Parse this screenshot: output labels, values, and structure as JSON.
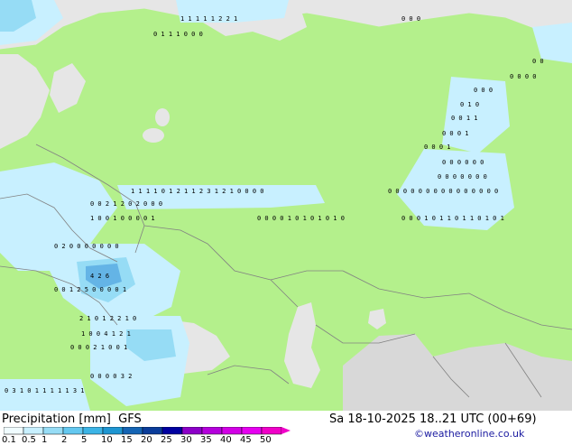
{
  "colors": {
    "land": "#b4f08c",
    "sea": "#e6e6e6",
    "precip_light": "#c8f0ff",
    "precip_mid": "#96dcf5",
    "precip_heavy": "#64b4e6",
    "precip_core": "#3c8cdc",
    "border": "#828282"
  },
  "footer": {
    "title": "Precipitation [mm]",
    "model": "GFS",
    "valid_time": "Sa 18-10-2025 18..21 UTC (00+69)",
    "credit": "©weatheronline.co.uk"
  },
  "legend": {
    "labels": [
      "0.1",
      "0.5",
      "1",
      "2",
      "5",
      "10",
      "15",
      "20",
      "25",
      "30",
      "35",
      "40",
      "45",
      "50"
    ],
    "colors": [
      "#f0fcff",
      "#c8f0ff",
      "#96dcf5",
      "#64c8f0",
      "#3cb4e6",
      "#1e96d2",
      "#1464b4",
      "#0a3c9a",
      "#0000a0",
      "#8c00c8",
      "#b400dc",
      "#d200e6",
      "#e600f0",
      "#f000c8"
    ]
  },
  "map_values": [
    {
      "t": "1 1 1 1 1 2 2 1",
      "id": "r1"
    },
    {
      "t": "0 1 1 1   0 0 0",
      "id": "r2"
    },
    {
      "t": "0 0 0",
      "id": "r3"
    },
    {
      "t": "0 0",
      "id": "r4"
    },
    {
      "t": "0 0 0 0",
      "id": "r5"
    },
    {
      "t": "0 0 0",
      "id": "r6"
    },
    {
      "t": "0 1 0",
      "id": "r7"
    },
    {
      "t": "0 0 1 1",
      "id": "r8"
    },
    {
      "t": "0 0 0 1",
      "id": "r9"
    },
    {
      "t": "0 0 0 1",
      "id": "r10"
    },
    {
      "t": "0 0 0 0 0 0",
      "id": "r11"
    },
    {
      "t": "0 0 0 0 0 0 0",
      "id": "r12"
    },
    {
      "t": "1 1 1 1 0 1 2 1 1 2 3 1 2 1 0 0   0 0",
      "id": "r13"
    },
    {
      "t": "0 0 2 1 2 0 2 0 0 0",
      "id": "r14"
    },
    {
      "t": "0 0 0 0 0 0 0 0 0 0 0 0 0 0 0",
      "id": "r15"
    },
    {
      "t": "0 0 0 1 0 1 1 0 1 1 0 1 0 1",
      "id": "r16"
    },
    {
      "t": "1 0 0   1 0   0 0 0 1",
      "id": "r17"
    },
    {
      "t": "0 0 0 0 1 0 1 0 1 0 1 0",
      "id": "r18"
    },
    {
      "t": "0 2 0   0 0 0 0 0 0",
      "id": "r19"
    },
    {
      "t": "4 2 6",
      "id": "r20"
    },
    {
      "t": "0 0 1 2 5 0 0 0 0 1",
      "id": "r21"
    },
    {
      "t": "2 1 0   1 2 2 1 0",
      "id": "r22"
    },
    {
      "t": "1 0   0 4 1 2 1",
      "id": "r23"
    },
    {
      "t": "0 0 0 2 1 0 0 1",
      "id": "r24"
    },
    {
      "t": "0 0 0 0 3 2",
      "id": "r25"
    },
    {
      "t": "0 3 1 0 1 1 1   1 1 3 1",
      "id": "r26"
    }
  ]
}
